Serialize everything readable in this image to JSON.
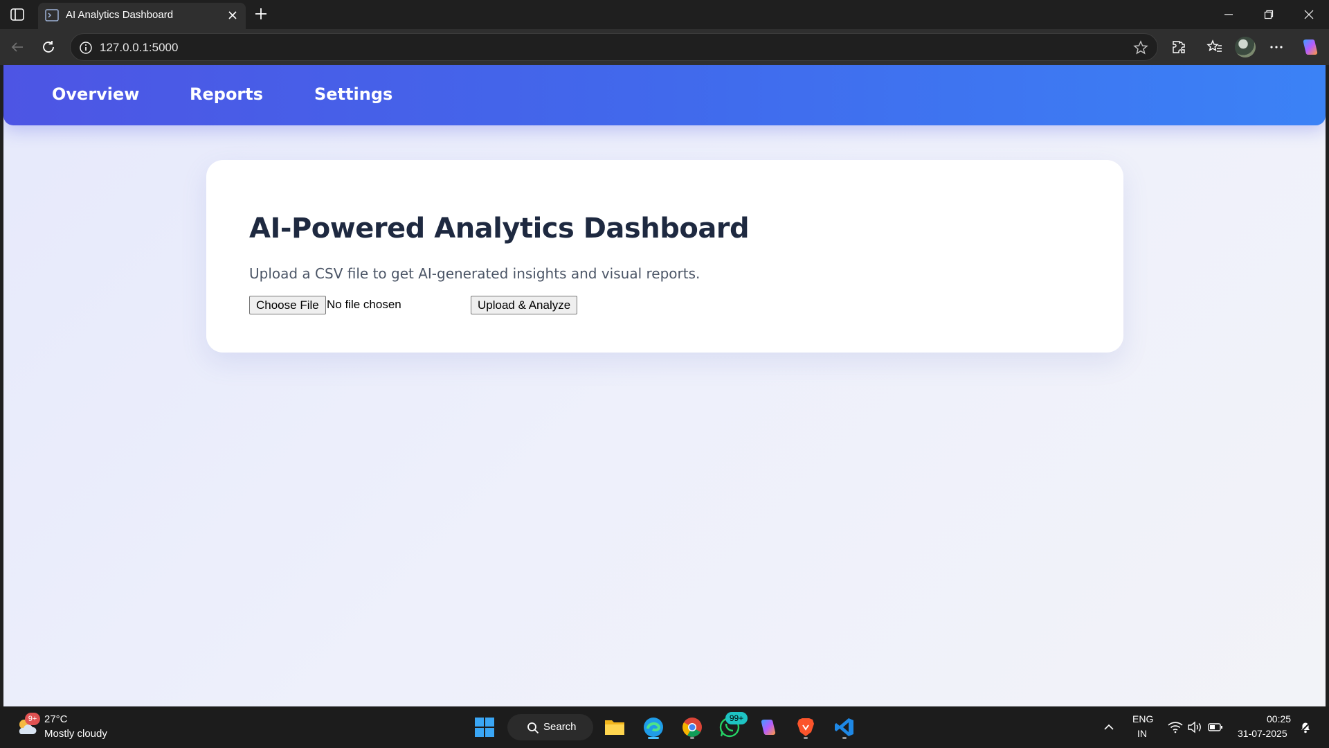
{
  "browser": {
    "tab_title": "AI Analytics Dashboard",
    "url": "127.0.0.1:5000"
  },
  "navbar": {
    "links": [
      {
        "label": "Overview"
      },
      {
        "label": "Reports"
      },
      {
        "label": "Settings"
      }
    ],
    "gradient_colors": [
      "#4d55e4",
      "#3b82f6"
    ]
  },
  "card": {
    "title": "AI-Powered Analytics Dashboard",
    "subtitle": "Upload a CSV file to get AI-generated insights and visual reports.",
    "choose_file_label": "Choose File",
    "file_status": "No file chosen",
    "upload_button_label": "Upload & Analyze"
  },
  "taskbar": {
    "weather_badge": "9+",
    "weather_temp": "27°C",
    "weather_desc": "Mostly cloudy",
    "search_label": "Search",
    "whatsapp_badge": "99+",
    "language": "ENG",
    "region": "IN",
    "time": "00:25",
    "date": "31-07-2025"
  },
  "colors": {
    "title_text": "#1e2940",
    "page_background": "#eef0fb",
    "accent_blue": "#3b82f6"
  }
}
